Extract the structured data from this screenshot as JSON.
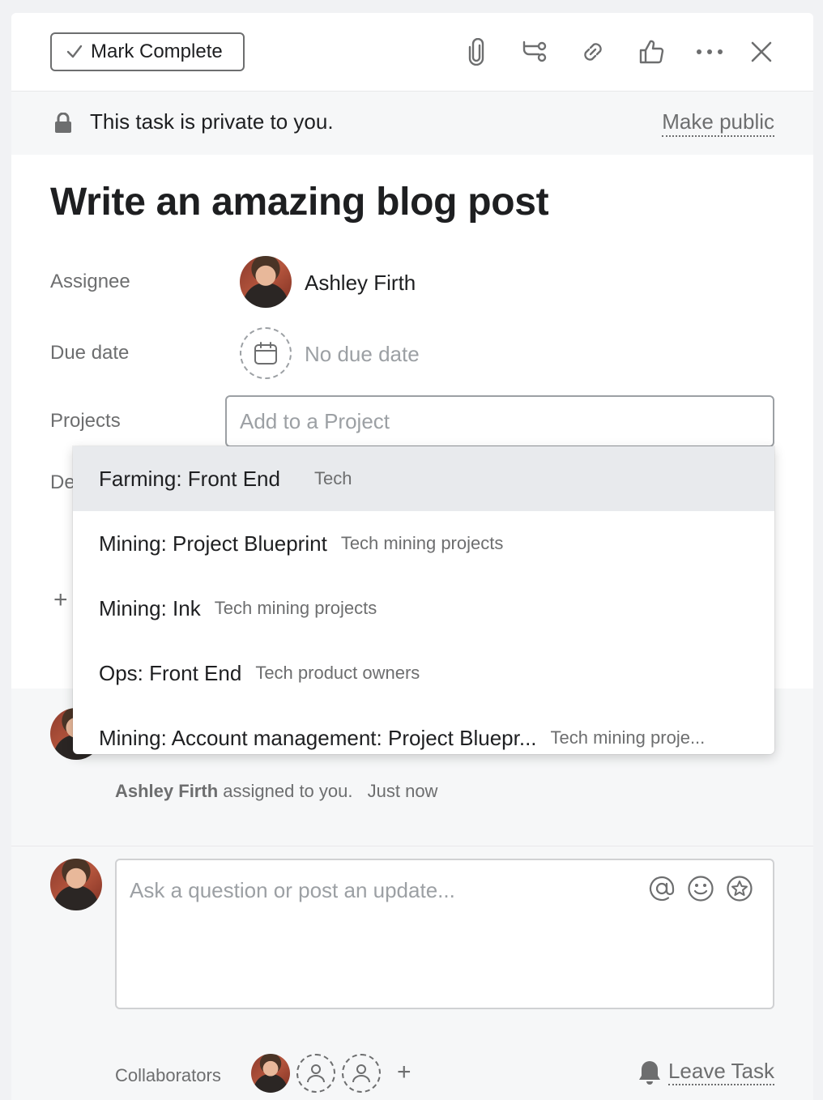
{
  "toolbar": {
    "mark_complete_label": "Mark Complete",
    "icons": [
      "paperclip-icon",
      "subtask-icon",
      "link-icon",
      "thumbs-up-icon",
      "more-icon",
      "close-icon"
    ]
  },
  "privacy": {
    "message": "This task is private to you.",
    "make_public_label": "Make public"
  },
  "task": {
    "title": "Write an amazing blog post",
    "assignee_label": "Assignee",
    "assignee_name": "Ashley Firth",
    "due_date_label": "Due date",
    "due_date_value": "No due date",
    "projects_label": "Projects",
    "projects_placeholder": "Add to a Project",
    "description_label_partial": "De"
  },
  "project_dropdown": {
    "items": [
      {
        "name": "Farming: Front End",
        "team": "Tech"
      },
      {
        "name": "Mining: Project Blueprint",
        "team": "Tech mining projects"
      },
      {
        "name": "Mining: Ink",
        "team": "Tech mining projects"
      },
      {
        "name": "Ops: Front End",
        "team": "Tech product owners"
      },
      {
        "name": "Mining: Account management: Project Bluepr...",
        "team": "Tech mining proje..."
      }
    ]
  },
  "activity": {
    "actor": "Ashley Firth",
    "action": "assigned to you.",
    "time": "Just now"
  },
  "comment": {
    "placeholder": "Ask a question or post an update..."
  },
  "footer": {
    "collaborators_label": "Collaborators",
    "leave_task_label": "Leave Task"
  },
  "colors": {
    "text_primary": "#1e1f21",
    "text_secondary": "#6d6e6f",
    "placeholder": "#9ca0a4",
    "highlight": "#e8eaed"
  }
}
